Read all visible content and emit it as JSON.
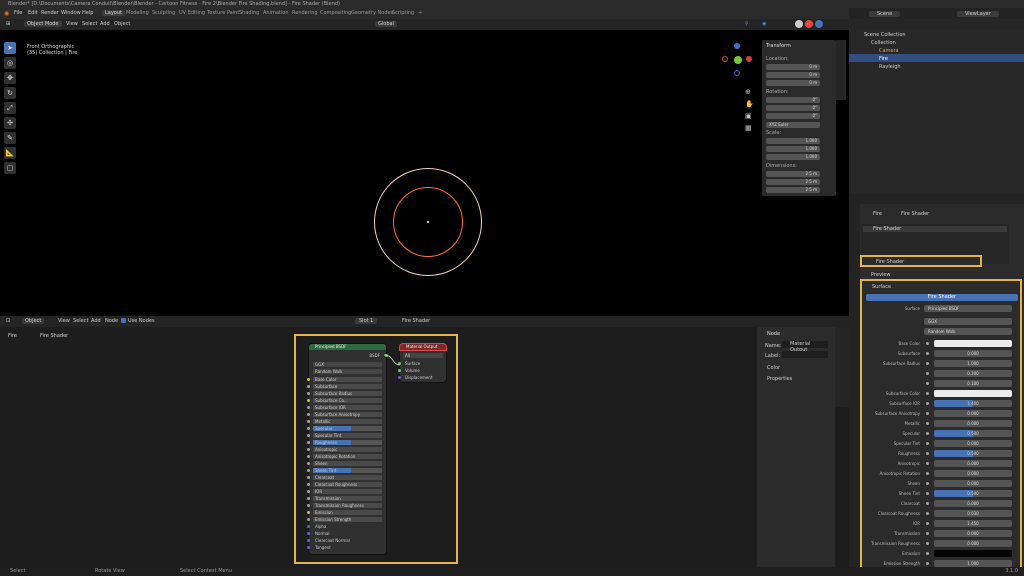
{
  "title": "Blender* [D:\\Documents\\Camera Conduit\\Blender\\Blender - Cartoon Fitness - Fire 2\\Blender Fire Shading.blend] - Fire Shader (Blend)",
  "menu": [
    "File",
    "Edit",
    "Render",
    "Window",
    "Help"
  ],
  "workspaces": [
    "Layout",
    "Modeling",
    "Sculpting",
    "UV Editing",
    "Texture Paint",
    "Shading",
    "Animation",
    "Rendering",
    "Compositing",
    "Geometry Nodes",
    "Scripting"
  ],
  "viewport": {
    "mode": "Object Mode",
    "menus": [
      "View",
      "Select",
      "Add",
      "Object"
    ],
    "overlay_title": "Front Orthographic",
    "overlay_sub": "(35) Collection | Fire",
    "transform": "Global"
  },
  "npanel": {
    "title": "Transform",
    "location_label": "Location:",
    "location": [
      "0 m",
      "0 m",
      "0 m"
    ],
    "rotation_label": "Rotation:",
    "rotation": [
      "0°",
      "0°",
      "0°"
    ],
    "rotation_mode": "XYZ Euler",
    "scale_label": "Scale:",
    "scale": [
      "1.000",
      "1.000",
      "1.000"
    ],
    "dimensions_label": "Dimensions:",
    "dimensions": [
      "2.5 m",
      "2.5 m",
      "2.5 m"
    ],
    "axis": [
      "X",
      "Y",
      "Z"
    ]
  },
  "outliner": {
    "scene": "Scene",
    "view_layer": "ViewLayer",
    "root": "Scene Collection",
    "items": [
      "Collection",
      "Camera",
      "Fire",
      "Rayleigh"
    ]
  },
  "properties": {
    "object": "Fire",
    "material": "Fire Shader",
    "slot": "Fire Shader",
    "active_material": "Fire Shader",
    "preview": "Preview",
    "surface_section": "Surface",
    "surface_btn": "Fire Shader",
    "surface_label": "Surface",
    "surface_value": "Principled BSDF",
    "dist": "GGX",
    "sss_method": "Random Walk",
    "rows": [
      {
        "l": "Base Color",
        "v": "",
        "kind": "white"
      },
      {
        "l": "Subsurface",
        "v": "0.000"
      },
      {
        "l": "Subsurface Radius",
        "v": "1.000"
      },
      {
        "l": "",
        "v": "0.200"
      },
      {
        "l": "",
        "v": "0.100"
      },
      {
        "l": "Subsurface Color",
        "v": "",
        "kind": "white"
      },
      {
        "l": "Subsurface IOR",
        "v": "1.400",
        "kind": "blue"
      },
      {
        "l": "Subsurface Anisotropy",
        "v": "0.000"
      },
      {
        "l": "Metallic",
        "v": "0.000"
      },
      {
        "l": "Specular",
        "v": "0.500",
        "kind": "blue"
      },
      {
        "l": "Specular Tint",
        "v": "0.000"
      },
      {
        "l": "Roughness",
        "v": "0.500",
        "kind": "blue"
      },
      {
        "l": "Anisotropic",
        "v": "0.000"
      },
      {
        "l": "Anisotropic Rotation",
        "v": "0.000"
      },
      {
        "l": "Sheen",
        "v": "0.000"
      },
      {
        "l": "Sheen Tint",
        "v": "0.500",
        "kind": "blue"
      },
      {
        "l": "Clearcoat",
        "v": "0.000"
      },
      {
        "l": "Clearcoat Roughness",
        "v": "0.030"
      },
      {
        "l": "IOR",
        "v": "1.450"
      },
      {
        "l": "Transmission",
        "v": "0.000"
      },
      {
        "l": "Transmission Roughness",
        "v": "0.000"
      },
      {
        "l": "Emission",
        "v": "",
        "kind": "black"
      },
      {
        "l": "Emission Strength",
        "v": "1.000"
      }
    ]
  },
  "node_editor": {
    "mode": "Object",
    "menus": [
      "View",
      "Select",
      "Add",
      "Node"
    ],
    "use_nodes": "Use Nodes",
    "slot": "Slot 1",
    "material": "Fire Shader",
    "breadcrumb_obj": "Fire",
    "breadcrumb_mat": "Fire Shader"
  },
  "bsdf": {
    "title": "Principled BSDF",
    "out": "BSDF",
    "dist": "GGX",
    "sss": "Random Walk",
    "rows": [
      "Base Color",
      "Subsurface",
      "Subsurface Radius",
      "Subsurface Co...",
      "Subsurface IOR",
      "Subsurface Anisotropy",
      "Metallic",
      "Specular",
      "Specular Tint",
      "Roughness",
      "Anisotropic",
      "Anisotropic Rotation",
      "Sheen",
      "Sheen Tint",
      "Clearcoat",
      "Clearcoat Roughness",
      "IOR",
      "Transmission",
      "Transmission Roughness",
      "Emission",
      "Emission Strength",
      "Alpha",
      "Normal",
      "Clearcoat Normal",
      "Tangent"
    ]
  },
  "matout": {
    "title": "Material Output",
    "target": "All",
    "rows": [
      "Surface",
      "Volume",
      "Displacement"
    ]
  },
  "node_side": {
    "section": "Node",
    "name_label": "Name:",
    "name": "Material Output",
    "label_label": "Label:",
    "color": "Color",
    "props": "Properties"
  },
  "status": [
    "Select",
    "Rotate View",
    "Select Context Menu"
  ],
  "version": "3.1.0",
  "colors": {
    "accent": "#4772b3",
    "highlight": "#e3b44d",
    "ring_outer": "#f4cfc8",
    "ring_inner": "#ff6d33"
  }
}
